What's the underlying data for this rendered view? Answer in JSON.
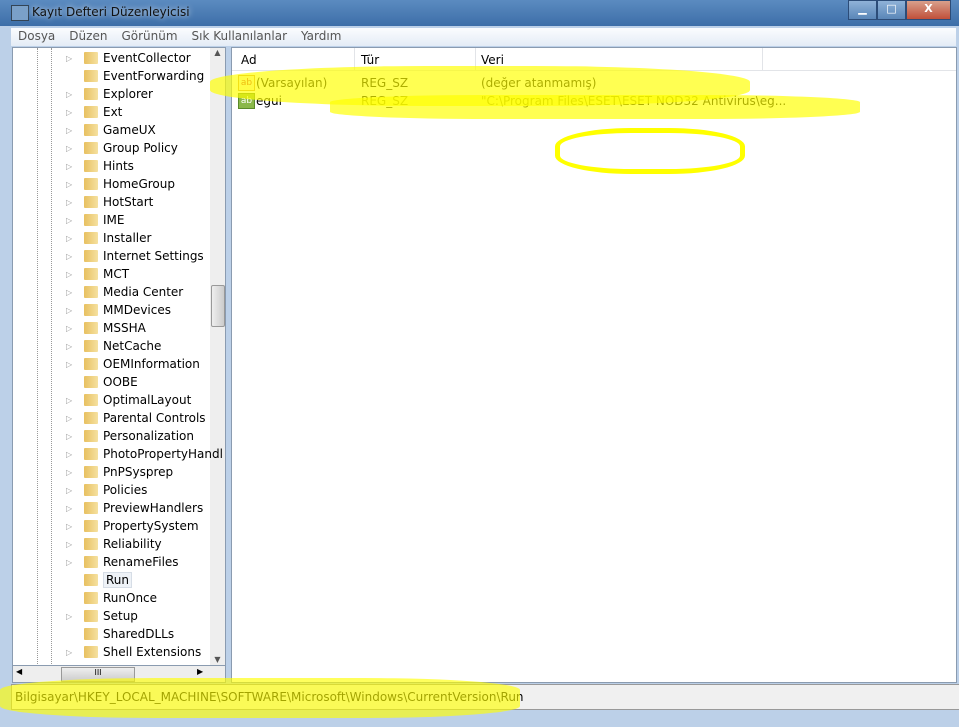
{
  "window": {
    "title": "Kayıt Defteri Düzenleyicisi",
    "minimize": "▁",
    "maximize": "□",
    "close": "X"
  },
  "menu": [
    "Dosya",
    "Düzen",
    "Görünüm",
    "Sık Kullanılanlar",
    "Yardım"
  ],
  "tree": {
    "items": [
      {
        "label": "EventCollector",
        "expandable": true
      },
      {
        "label": "EventForwarding",
        "expandable": false
      },
      {
        "label": "Explorer",
        "expandable": true
      },
      {
        "label": "Ext",
        "expandable": true
      },
      {
        "label": "GameUX",
        "expandable": true
      },
      {
        "label": "Group Policy",
        "expandable": true
      },
      {
        "label": "Hints",
        "expandable": true
      },
      {
        "label": "HomeGroup",
        "expandable": true
      },
      {
        "label": "HotStart",
        "expandable": true
      },
      {
        "label": "IME",
        "expandable": true
      },
      {
        "label": "Installer",
        "expandable": true
      },
      {
        "label": "Internet Settings",
        "expandable": true
      },
      {
        "label": "MCT",
        "expandable": true
      },
      {
        "label": "Media Center",
        "expandable": true
      },
      {
        "label": "MMDevices",
        "expandable": true
      },
      {
        "label": "MSSHA",
        "expandable": true
      },
      {
        "label": "NetCache",
        "expandable": true
      },
      {
        "label": "OEMInformation",
        "expandable": true
      },
      {
        "label": "OOBE",
        "expandable": false
      },
      {
        "label": "OptimalLayout",
        "expandable": true
      },
      {
        "label": "Parental Controls",
        "expandable": true
      },
      {
        "label": "Personalization",
        "expandable": true
      },
      {
        "label": "PhotoPropertyHandl",
        "expandable": true
      },
      {
        "label": "PnPSysprep",
        "expandable": true
      },
      {
        "label": "Policies",
        "expandable": true
      },
      {
        "label": "PreviewHandlers",
        "expandable": true
      },
      {
        "label": "PropertySystem",
        "expandable": true
      },
      {
        "label": "Reliability",
        "expandable": true
      },
      {
        "label": "RenameFiles",
        "expandable": true
      },
      {
        "label": "Run",
        "expandable": false,
        "selected": true
      },
      {
        "label": "RunOnce",
        "expandable": false
      },
      {
        "label": "Setup",
        "expandable": true
      },
      {
        "label": "SharedDLLs",
        "expandable": false
      },
      {
        "label": "Shell Extensions",
        "expandable": true
      }
    ],
    "hscroll_grip": "III"
  },
  "list": {
    "columns": [
      "Ad",
      "Tür",
      "Veri"
    ],
    "rows": [
      {
        "icon": "string-value-icon",
        "icon_text": "ab",
        "name": "(Varsayılan)",
        "type": "REG_SZ",
        "data": "(değer atanmamış)"
      },
      {
        "icon": "string-value-icon",
        "icon_text": "ab",
        "name": "egui",
        "type": "REG_SZ",
        "data": "\"C:\\Program Files\\ESET\\ESET NOD32 Antivirus\\eg..."
      }
    ]
  },
  "status": "Bilgisayar\\HKEY_LOCAL_MACHINE\\SOFTWARE\\Microsoft\\Windows\\CurrentVersion\\Run",
  "colors": {
    "highlight": "#ffff00",
    "titlebar": "#4a7ab4"
  }
}
